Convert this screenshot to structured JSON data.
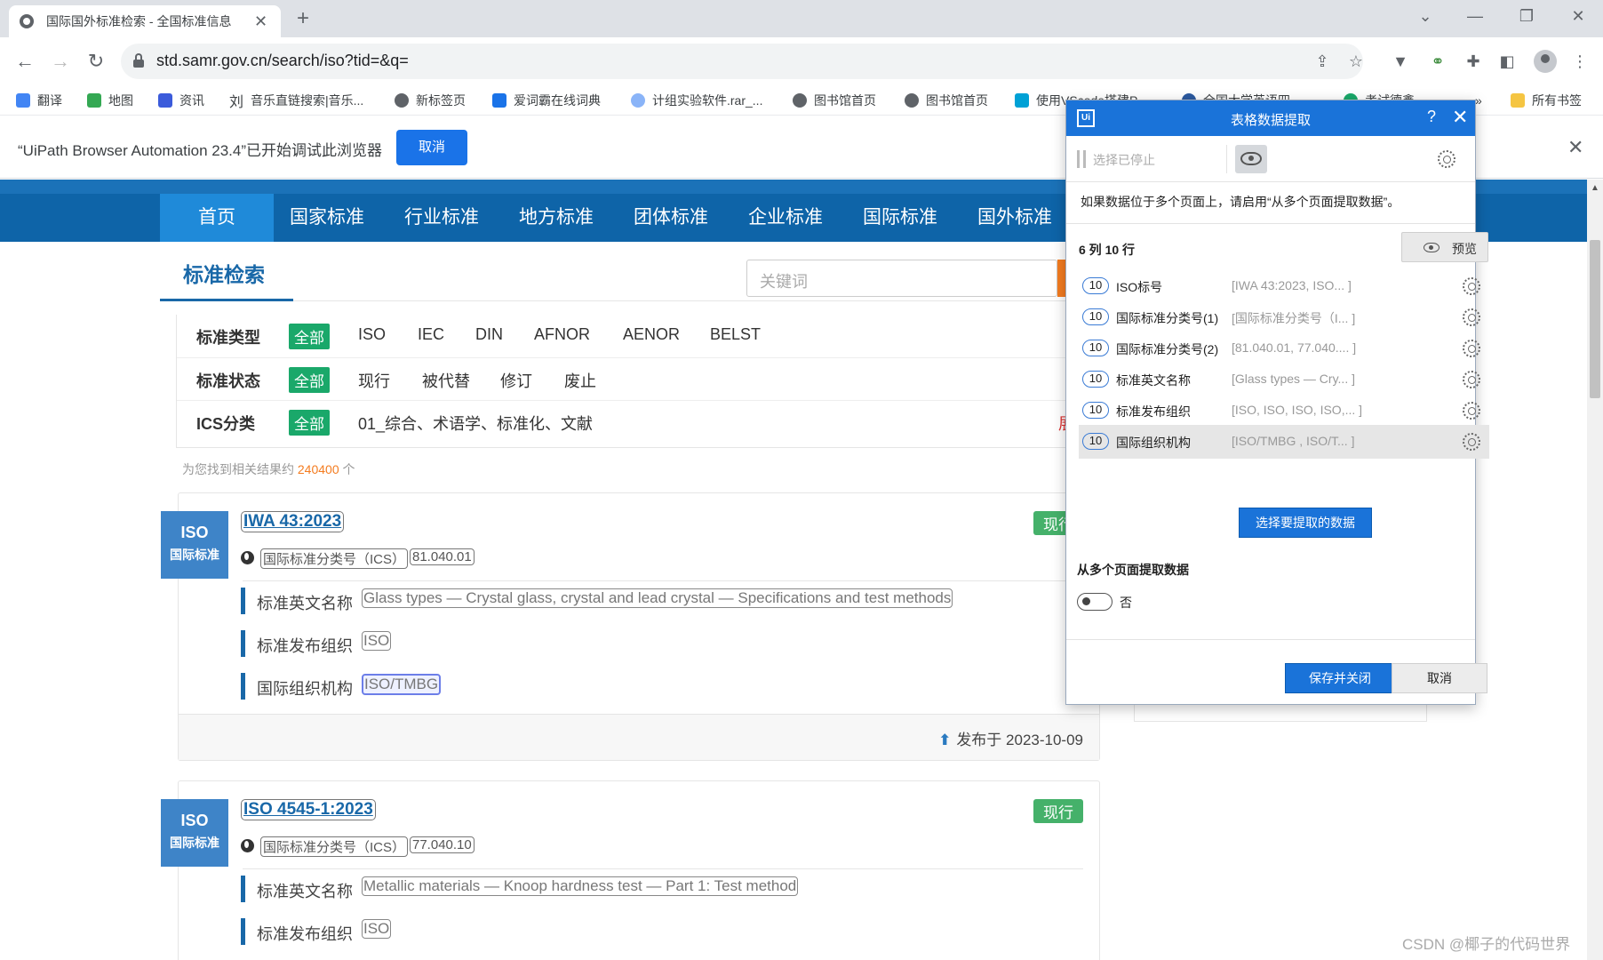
{
  "browser": {
    "tab_title": "国际国外标准检索 - 全国标准信息",
    "url": "std.samr.gov.cn/search/iso?tid=&q=",
    "bookmarks": [
      "翻译",
      "地图",
      "资讯",
      "音乐直链搜索|音乐...",
      "新标签页",
      "爱词霸在线词典",
      "计组实验软件.rar_...",
      "图书馆首页",
      "图书馆首页",
      "使用VScode搭建P...",
      "全国大学英语四...",
      "考试德鑫...",
      "»",
      "所有书签"
    ],
    "bookmark_prefix_glyph": "刘",
    "debug_bar": {
      "text": "“UiPath Browser Automation 23.4”已开始调试此浏览器",
      "cancel_label": "取消"
    }
  },
  "page": {
    "nav": [
      "首页",
      "国家标准",
      "行业标准",
      "地方标准",
      "团体标准",
      "企业标准",
      "国际标准",
      "国外标准"
    ],
    "search_title": "标准检索",
    "keyword_placeholder": "关键词",
    "filters": {
      "type": {
        "label": "标准类型",
        "options": [
          "全部",
          "ISO",
          "IEC",
          "DIN",
          "AFNOR",
          "AENOR",
          "BELST"
        ]
      },
      "status": {
        "label": "标准状态",
        "options": [
          "全部",
          "现行",
          "被代替",
          "修订",
          "废止"
        ]
      },
      "ics": {
        "label": "ICS分类",
        "options": [
          "全部",
          "01_综合、术语学、标准化、文献"
        ],
        "more": "展"
      }
    },
    "result_count": {
      "prefix": "为您找到相关结果约 ",
      "count": "240400",
      "suffix": " 个"
    },
    "results": [
      {
        "badge_line1": "ISO",
        "badge_line2": "国际标准",
        "number": "IWA 43:2023",
        "status": "现行",
        "ics_label": "国际标准分类号（ICS）",
        "ics_code": "81.040.01",
        "fields": [
          {
            "name": "标准英文名称",
            "value": "Glass types — Crystal glass, crystal and lead crystal — Specifications and test methods"
          },
          {
            "name": "标准发布组织",
            "value": "ISO"
          },
          {
            "name": "国际组织机构",
            "value": "ISO/TMBG"
          }
        ],
        "published": "发布于 2023-10-09"
      },
      {
        "badge_line1": "ISO",
        "badge_line2": "国际标准",
        "number": "ISO 4545-1:2023",
        "status": "现行",
        "ics_label": "国际标准分类号（ICS）",
        "ics_code": "77.040.10",
        "fields": [
          {
            "name": "标准英文名称",
            "value": "Metallic materials — Knoop hardness test — Part 1: Test method"
          },
          {
            "name": "标准发布组织",
            "value": "ISO"
          }
        ]
      }
    ],
    "watermark": "CSDN @椰子的代码世界"
  },
  "dialog": {
    "title": "表格数据提取",
    "help": "?",
    "selection_stopped": "选择已停止",
    "info": "如果数据位于多个页面上，请启用“从多个页面提取数据”。",
    "col_count": "6 列",
    "row_count": "10 行",
    "preview_label": "预览",
    "columns": [
      {
        "count": "10",
        "name": "ISO标号",
        "preview": "[IWA 43:2023, ISO... ]"
      },
      {
        "count": "10",
        "name": "国际标准分类号(1)",
        "preview": "[国际标准分类号（I... ]"
      },
      {
        "count": "10",
        "name": "国际标准分类号(2)",
        "preview": "[81.040.01, 77.040.... ]"
      },
      {
        "count": "10",
        "name": "标准英文名称",
        "preview": "[Glass types — Cry... ]"
      },
      {
        "count": "10",
        "name": "标准发布组织",
        "preview": "[ISO, ISO, ISO, ISO,... ]"
      },
      {
        "count": "10",
        "name": "国际组织机构",
        "preview": "[ISO/TMBG , ISO/T... ]"
      }
    ],
    "select_data_label": "选择要提取的数据",
    "multi_page_title": "从多个页面提取数据",
    "multi_page_value": "否",
    "save_label": "保存并关闭",
    "cancel_label": "取消"
  }
}
